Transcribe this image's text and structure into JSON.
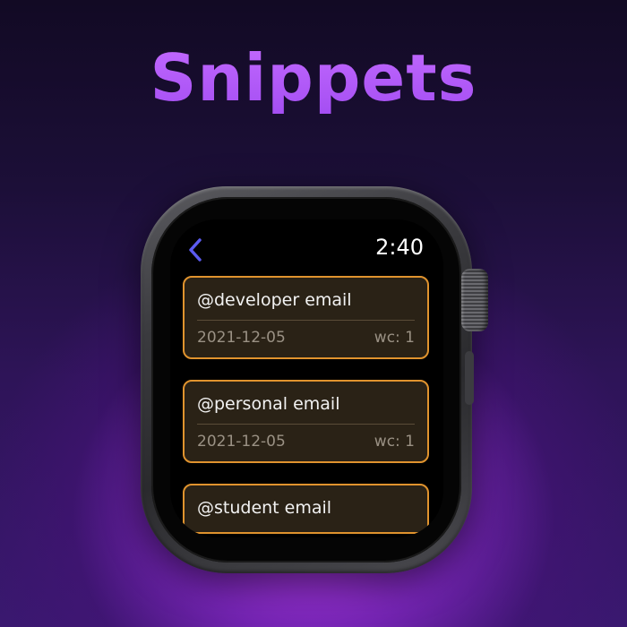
{
  "header": {
    "title": "Snippets"
  },
  "watch": {
    "status": {
      "back_icon": "chevron-left-icon",
      "time": "2:40"
    },
    "snippets": [
      {
        "name": "@developer email",
        "date": "2021-12-05",
        "wc": "wc: 1"
      },
      {
        "name": "@personal email",
        "date": "2021-12-05",
        "wc": "wc: 1"
      },
      {
        "name": "@student email",
        "date": "",
        "wc": ""
      }
    ]
  },
  "colors": {
    "title": "#b95cf7",
    "card_border": "#e0932e",
    "card_background": "#2a2216",
    "back_icon": "#5b5bf0"
  }
}
